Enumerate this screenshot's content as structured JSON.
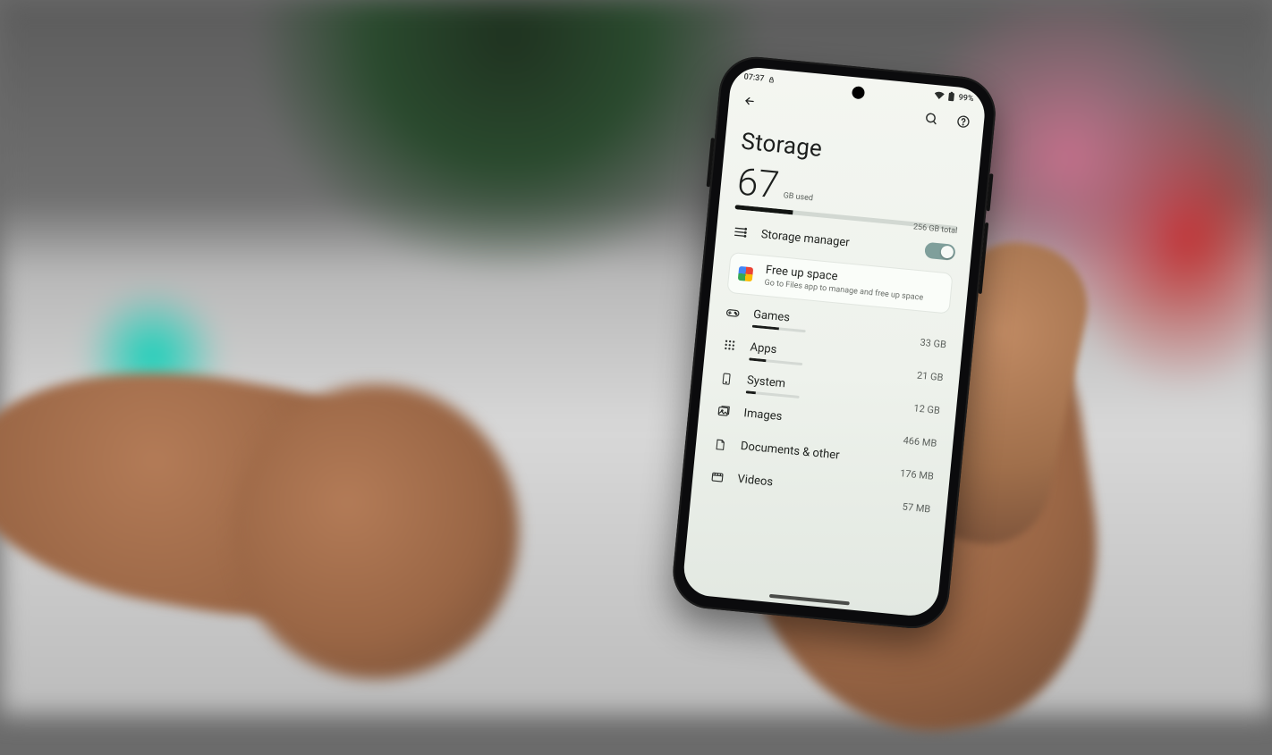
{
  "statusbar": {
    "time": "07:37",
    "battery_text": "99%"
  },
  "appbar": {},
  "page": {
    "title": "Storage"
  },
  "usage": {
    "used_value": "67",
    "used_unit": "GB used",
    "total_label": "256 GB total",
    "used_percent": 26
  },
  "storage_manager": {
    "label": "Storage manager",
    "enabled": true
  },
  "free_up": {
    "title": "Free up space",
    "subtitle": "Go to Files app to manage and free up space"
  },
  "categories": [
    {
      "id": "games",
      "label": "Games",
      "size": "33 GB",
      "bar_pct": 50
    },
    {
      "id": "apps",
      "label": "Apps",
      "size": "21 GB",
      "bar_pct": 32
    },
    {
      "id": "system",
      "label": "System",
      "size": "12 GB",
      "bar_pct": 18
    },
    {
      "id": "images",
      "label": "Images",
      "size": "466 MB",
      "bar_pct": 0
    },
    {
      "id": "docs",
      "label": "Documents & other",
      "size": "176 MB",
      "bar_pct": 0
    },
    {
      "id": "videos",
      "label": "Videos",
      "size": "57 MB",
      "bar_pct": 0
    }
  ]
}
